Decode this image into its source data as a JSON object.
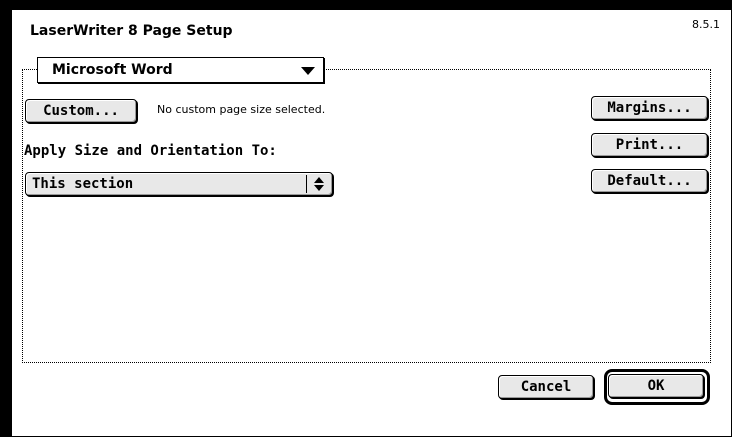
{
  "dialog": {
    "title": "LaserWriter 8 Page Setup",
    "version": "8.5.1"
  },
  "app_popup": {
    "selected": "Microsoft Word",
    "icon": "chevron-down-icon"
  },
  "custom": {
    "button_label": "Custom...",
    "status_text": "No custom page size selected."
  },
  "apply": {
    "label": "Apply Size and Orientation To:",
    "selected": "This section",
    "icon": "up-down-arrows-icon"
  },
  "side_buttons": {
    "margins": "Margins...",
    "print": "Print...",
    "default": "Default..."
  },
  "footer": {
    "cancel": "Cancel",
    "ok": "OK"
  }
}
